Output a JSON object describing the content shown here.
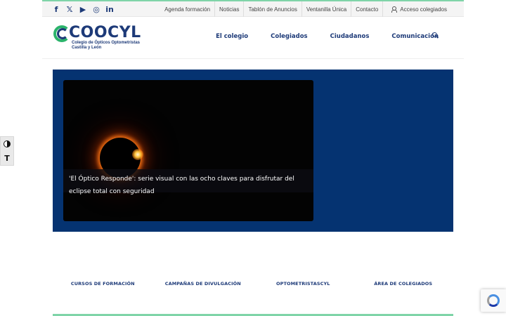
{
  "topbar": {
    "social": [
      {
        "icon": "facebook-icon",
        "glyph": "f"
      },
      {
        "icon": "x-twitter-icon",
        "glyph": "𝕏"
      },
      {
        "icon": "youtube-icon",
        "glyph": "▶"
      },
      {
        "icon": "instagram-icon",
        "glyph": "◎"
      },
      {
        "icon": "linkedin-icon",
        "glyph": "in"
      }
    ],
    "links": [
      "Agenda formación",
      "Noticias",
      "Tablón de Anuncios",
      "Ventanilla Única",
      "Contacto"
    ],
    "acceso": "Acceso colegiados"
  },
  "header": {
    "logo_text": "COOCYL",
    "logo_sub_line1": "Colegio de Ópticos Optometristas",
    "logo_sub_line2": "Castilla y León",
    "nav": [
      "El colegio",
      "Colegiados",
      "Ciudadanos",
      "Comunicación"
    ]
  },
  "hero": {
    "caption": "'El Óptico Responde': serie visual con las ocho claves para disfrutar del eclipse total con seguridad"
  },
  "quick_links": [
    "CURSOS DE FORMACIÓN",
    "CAMPAÑAS DE DIVULGACIÓN",
    "OPTOMETRISTASCYL",
    "ÁREA DE COLEGIADOS"
  ],
  "a11y": {
    "contrast_icon": "contrast-icon",
    "font_glyph": "T"
  },
  "colors": {
    "brand_blue": "#1d3a78",
    "hero_bg": "#053371",
    "accent_green": "#7fd4a8"
  }
}
